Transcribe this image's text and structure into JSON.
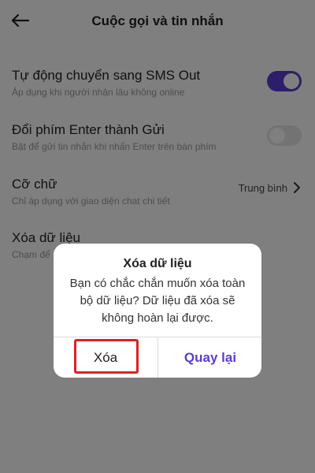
{
  "header": {
    "title": "Cuộc gọi và tin nhắn",
    "back_icon": "arrow-left-icon"
  },
  "settings": [
    {
      "title": "Tự động chuyển sang SMS Out",
      "desc": "Áp dụng khi người nhận lâu không online",
      "control": "toggle",
      "state": "on"
    },
    {
      "title": "Đổi phím Enter thành Gửi",
      "desc": "Bật để gửi tin nhắn khi nhấn Enter trên bàn phím",
      "control": "toggle",
      "state": "off"
    },
    {
      "title": "Cỡ chữ",
      "desc": "Chỉ áp dụng với giao diện chat chi tiết",
      "control": "select",
      "value": "Trung bình"
    },
    {
      "title": "Xóa dữ liệu",
      "desc": "Chạm để",
      "control": "none"
    }
  ],
  "dialog": {
    "title": "Xóa dữ liệu",
    "message": "Bạn có chắc chắn muốn xóa toàn bộ dữ liệu? Dữ liệu đã xóa sẽ không hoàn lại được.",
    "confirm_label": "Xóa",
    "cancel_label": "Quay lại"
  },
  "colors": {
    "accent": "#5c3bd1",
    "highlight": "#e02020",
    "overlay": "rgba(0,0,0,0.5)"
  }
}
